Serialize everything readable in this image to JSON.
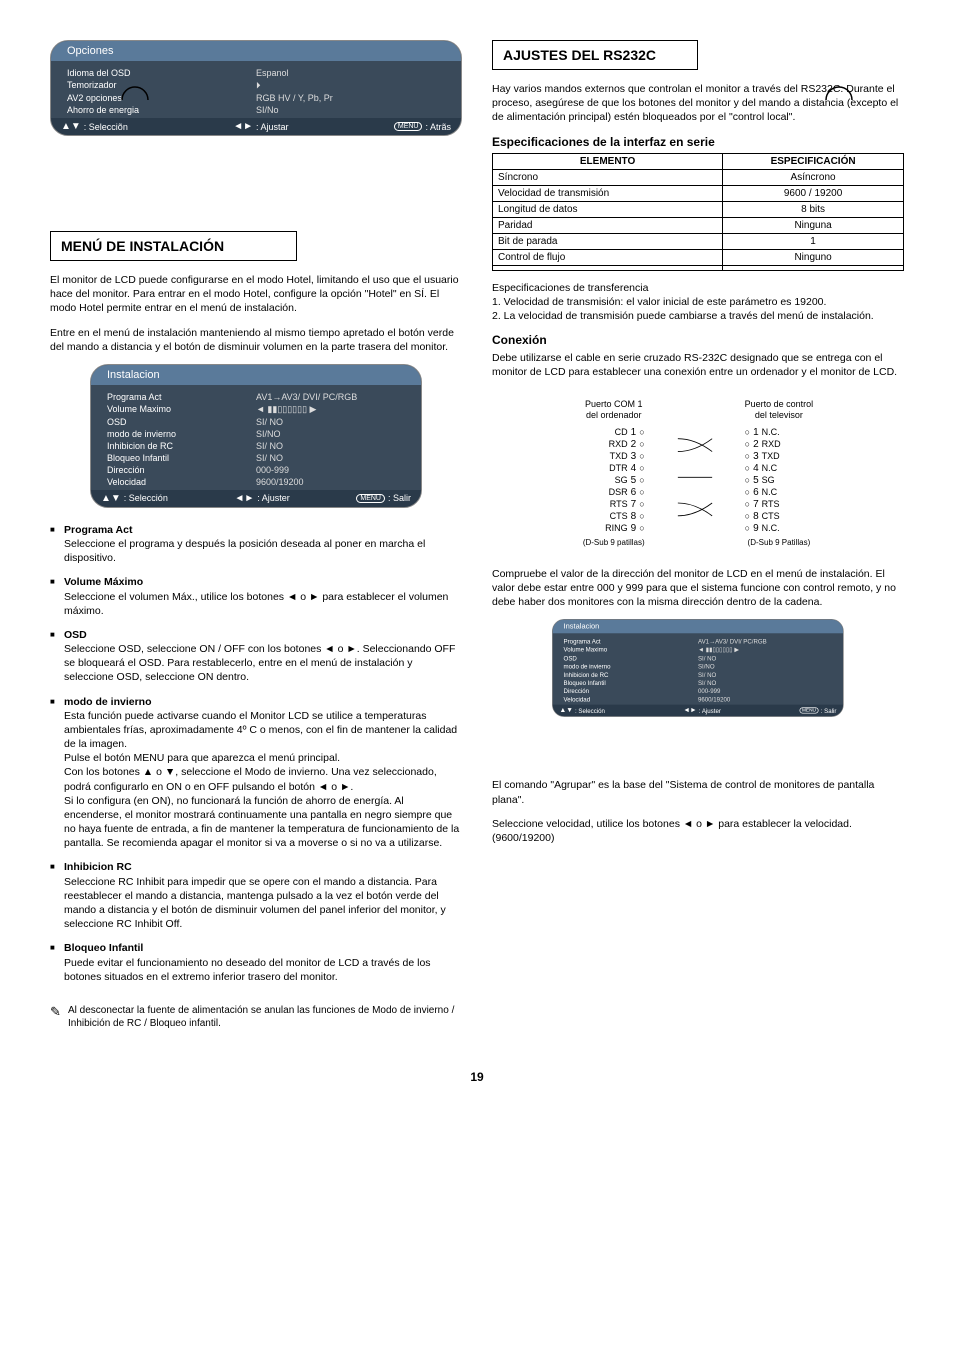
{
  "page_number": "19",
  "crop_icon": "◯",
  "options_menu": {
    "title": "Opciones",
    "rows": [
      {
        "label": "Idioma del OSD",
        "value": "Espanol"
      },
      {
        "label": "Temorizador",
        "value": "⏵"
      },
      {
        "label": "AV2 opciones",
        "value": "RGB HV / Y, Pb, Pr"
      },
      {
        "label": "Ahorro de energia",
        "value": "SI/No"
      }
    ],
    "footer": {
      "sel": ": Selecciõn",
      "adj": ": Ajustar",
      "back": ": Atrãs",
      "menu": "MENU"
    }
  },
  "install_title_box": "MENÚ DE INSTALACIÓN",
  "install_menu": {
    "title": "Instalacion",
    "rows": [
      {
        "label": "Programa Act",
        "value": "AV1→AV3/ DVI/ PC/RGB",
        "hl": true
      },
      {
        "label": "Volume Maximo",
        "value": "◄ ▮▮▯▯▯▯▯▯ ▶"
      },
      {
        "label": "OSD",
        "value": "SI/ NO"
      },
      {
        "label": "modo de invierno",
        "value": "SI/NO"
      },
      {
        "label": "Inhibicion de RC",
        "value": "SI/ NO"
      },
      {
        "label": "Bloqueo Infantil",
        "value": "SI/ NO"
      },
      {
        "label": "Dirección",
        "value": "000-999"
      },
      {
        "label": "Velocidad",
        "value": "9600/19200",
        "hl": true
      }
    ],
    "footer": {
      "sel": ": Selección",
      "adj": ": Ajuster",
      "back": ": Salir",
      "menu": "MENU"
    }
  },
  "install_intro": [
    "El monitor de LCD puede configurarse en el modo Hotel, limitando el uso que el usuario hace del monitor. Para entrar en el modo Hotel, configure la opción \"Hotel\" en SÍ. El modo Hotel permite entrar en el menú de instalación.",
    "Entre en el menú de instalación manteniendo al mismo tiempo apretado el botón verde del mando a distancia y el botón de disminuir volumen en la parte trasera del monitor."
  ],
  "install_items": [
    {
      "label": "Programa Act",
      "text": "Seleccione el programa y después la posición deseada al poner en marcha el dispositivo."
    },
    {
      "label": "Volume Máximo",
      "text": "Seleccione el volumen Máx., utilice los botones ◄ o ► para establecer el volumen máximo."
    },
    {
      "label": "OSD",
      "text": "Seleccione OSD, seleccione ON / OFF con los botones ◄ o ►. Seleccionando OFF se bloqueará el OSD. Para restablecerlo, entre en el menú de instalación y seleccione OSD, seleccione ON dentro."
    },
    {
      "label": "modo de invierno",
      "text": "Esta función puede activarse cuando el Monitor LCD se utilice a temperaturas ambientales frías, aproximadamente 4º C o menos, con el fin de mantener la calidad de la imagen.\nPulse el botón MENU para que aparezca el menú principal.\nCon los botones ▲ o ▼, seleccione el Modo de invierno. Una vez seleccionado, podrá configurarlo en ON o en OFF pulsando el botón ◄ o ►.\nSi lo configura (en ON), no funcionará la función de ahorro de energía. Al encenderse, el monitor mostrará continuamente una pantalla en negro siempre que no haya fuente de entrada, a fin de mantener la temperatura de funcionamiento de la pantalla. Se recomienda apagar el monitor si va a moverse o si no va a utilizarse."
    },
    {
      "label": "Inhibicion RC",
      "text": "Seleccione RC Inhibit para impedir que se opere con el mando a distancia. Para reestablecer el mando a distancia, mantenga pulsado a la vez el botón verde del mando a distancia y el botón de disminuir volumen del panel inferior del monitor, y seleccione RC Inhibit Off."
    },
    {
      "label": "Bloqueo Infantil",
      "text": "Puede evitar el funcionamiento no deseado del monitor de LCD a través de los botones situados en el extremo inferior trasero del monitor."
    }
  ],
  "install_note": "Al desconectar la fuente de alimentación se anulan las funciones de Modo de invierno / Inhibición de RC / Bloqueo infantil.",
  "rs232_title": "AJUSTES DEL RS232C",
  "rs232_intro": "Hay varios mandos externos que controlan el monitor a través del RS232C. Durante el proceso, asegúrese de que los botones del monitor y del mando a distancia (excepto el de alimentación principal) estén bloqueados por el \"control local\".",
  "spec_table": {
    "headers": [
      "ELEMENTO",
      "ESPECIFICACIÓN"
    ],
    "rows": [
      [
        "Síncrono",
        "Asíncrono"
      ],
      [
        "Velocidad de transmisión",
        "9600 / 19200"
      ],
      [
        "Longitud de datos",
        "8 bits"
      ],
      [
        "Paridad",
        "Ninguna"
      ],
      [
        "Bit de parada",
        "1"
      ],
      [
        "Control de flujo",
        "Ninguno"
      ],
      [
        "",
        ""
      ]
    ]
  },
  "serial_subhead": "Especificaciones de la interfaz en serie",
  "serial_text": "Especificaciones de transferencia\n1. Velocidad de transmisión: el valor inicial de este parámetro es 19200.\n2. La velocidad de transmisión puede cambiarse a través del menú de instalación.",
  "conn_subhead": "Conexión",
  "conn_text": "Debe utilizarse el cable en serie cruzado RS-232C designado que se entrega con el monitor de LCD para establecer una conexión entre un ordenador y el monitor de LCD.",
  "conn": {
    "left_title": "Puerto COM 1\ndel ordenador",
    "right_title": "Puerto de control\ndel televisor",
    "left_pins": [
      {
        "n": "1",
        "l": "CD"
      },
      {
        "n": "2",
        "l": "RXD"
      },
      {
        "n": "3",
        "l": "TXD"
      },
      {
        "n": "4",
        "l": "DTR"
      },
      {
        "n": "5",
        "l": "SG"
      },
      {
        "n": "6",
        "l": "DSR"
      },
      {
        "n": "7",
        "l": "RTS"
      },
      {
        "n": "8",
        "l": "CTS"
      },
      {
        "n": "9",
        "l": "RING"
      }
    ],
    "right_pins": [
      {
        "n": "1",
        "l": "N.C."
      },
      {
        "n": "2",
        "l": "RXD"
      },
      {
        "n": "3",
        "l": "TXD"
      },
      {
        "n": "4",
        "l": "N.C"
      },
      {
        "n": "5",
        "l": "SG"
      },
      {
        "n": "6",
        "l": "N.C"
      },
      {
        "n": "7",
        "l": "RTS"
      },
      {
        "n": "8",
        "l": "CTS"
      },
      {
        "n": "9",
        "l": "N.C."
      }
    ],
    "left_sub": "(D-Sub  9 patillas)",
    "right_sub": "(D-Sub  9 Patillas)"
  },
  "addr_text": "Compruebe el valor de la dirección del monitor de LCD en el menú de instalación. El valor debe estar entre 000 y 999 para que el sistema funcione con control remoto, y no debe haber dos monitores con la misma dirección dentro de la cadena.",
  "addr_note": "El comando \"Agrupar\" es la base del \"Sistema de control de monitores de pantalla plana\".",
  "baud_text": "Seleccione velocidad, utilice los botones ◄ o ► para establecer la velocidad. (9600/19200)"
}
